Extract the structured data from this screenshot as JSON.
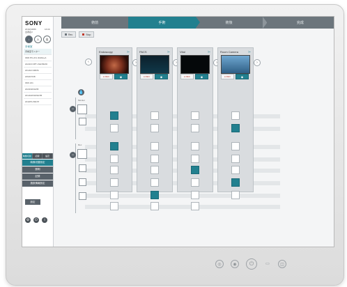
{
  "sidebar": {
    "brand": "SONY",
    "meta_lines": [
      "2019/1/8/66",
      "患者名3"
    ],
    "meta_right": "16:00",
    "toggles": [
      "↓",
      "入",
      "出"
    ],
    "section_label": "手術室",
    "rows": [
      "手術室モニター",
      "OR2 PC-ch1 ch2AA+A",
      "ch2ch3 OPT ch4ch5ch6",
      "ch1ch2 CMOS",
      "ch6ch7ch8",
      "OR1 ch1",
      "ch2ch3ch4ch5",
      "ch1ch2ch3ch4ch5",
      "ch4ch5 ch6ch7"
    ],
    "bottom_tabs": [
      "映像切替",
      "記録",
      "設定"
    ],
    "bottom_buttons": [
      "映像切替設定",
      "照明",
      "記録",
      "施設情報設定"
    ],
    "small_button": "設定",
    "footer_icons": [
      "gear-icon",
      "power-icon",
      "info-icon"
    ]
  },
  "workflow": {
    "steps": [
      "術前",
      "手術",
      "術後",
      "完成"
    ],
    "active_index": 1
  },
  "toolbar": {
    "buttons": [
      {
        "label": "Rec",
        "color": "#6c757c"
      },
      {
        "label": "Stop",
        "color": "#c0392b"
      }
    ]
  },
  "sources": [
    {
      "name": "Endoscopy",
      "thumb": "endo",
      "rec": "● REC",
      "cam": "📷"
    },
    {
      "name": "PACS",
      "thumb": "pace",
      "rec": "● REC",
      "cam": "📷"
    },
    {
      "name": "Vital",
      "thumb": "vital",
      "rec": "● REC",
      "cam": "📷"
    },
    {
      "name": "Room Camera",
      "thumb": "room",
      "rec": "● REC",
      "cam": "📷"
    }
  ],
  "matrix": {
    "rows": 8,
    "active": [
      [
        0,
        0
      ],
      [
        2,
        0
      ],
      [
        6,
        1
      ],
      [
        4,
        2
      ],
      [
        1,
        3
      ],
      [
        5,
        3
      ]
    ]
  },
  "left_controls": {
    "group_labels": [
      "Monitor",
      "Rec"
    ],
    "arrow_prev": "‹",
    "arrow_next": "›"
  },
  "colors": {
    "accent": "#22808f",
    "bar": "#6c757c",
    "rec_red": "#c0392b"
  }
}
